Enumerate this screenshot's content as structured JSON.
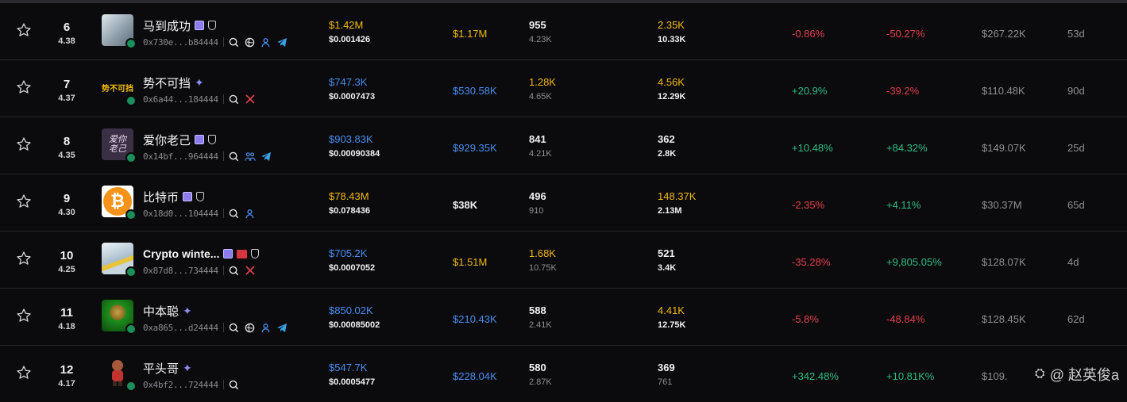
{
  "rows": [
    {
      "rank": "6",
      "score": "4.38",
      "name": "马到成功",
      "address": "0x730e...b84444",
      "avatar_colors": [
        "#c9d5de",
        "#7a8a96"
      ],
      "avatar_text": "",
      "market_cap": "$1.42M",
      "price": "$0.001426",
      "liquidity": "$1.17M",
      "txns": "955",
      "txns_sub": "4.23K",
      "volume": "2.35K",
      "volume_sub": "10.33K",
      "change_1": "-0.86%",
      "change_2": "-50.27%",
      "holders": "$267.22K",
      "age": "53d"
    },
    {
      "rank": "7",
      "score": "4.37",
      "name": "势不可挡",
      "address": "0x6a44...184444",
      "avatar_colors": [
        "#0b0b0d",
        "#0b0b0d"
      ],
      "avatar_text": "势不可挡",
      "market_cap": "$747.3K",
      "price": "$0.0007473",
      "liquidity": "$530.58K",
      "txns": "1.28K",
      "txns_sub": "4.65K",
      "volume": "4.56K",
      "volume_sub": "12.29K",
      "change_1": "+20.9%",
      "change_2": "-39.2%",
      "holders": "$110.48K",
      "age": "90d"
    },
    {
      "rank": "8",
      "score": "4.35",
      "name": "爱你老己",
      "address": "0x14bf...964444",
      "avatar_colors": [
        "#3b2f45",
        "#5d4a66"
      ],
      "avatar_text": "爱你老己",
      "market_cap": "$903.83K",
      "price": "$0.00090384",
      "liquidity": "$929.35K",
      "txns": "841",
      "txns_sub": "4.21K",
      "volume": "362",
      "volume_sub": "2.8K",
      "change_1": "+10.48%",
      "change_2": "+84.32%",
      "holders": "$149.07K",
      "age": "25d"
    },
    {
      "rank": "9",
      "score": "4.30",
      "name": "比特币",
      "address": "0x18d0...104444",
      "avatar_colors": [
        "#f7931a",
        "#f7931a"
      ],
      "avatar_text": "₿",
      "market_cap": "$78.43M",
      "price": "$0.078436",
      "liquidity": "$38K",
      "txns": "496",
      "txns_sub": "910",
      "volume": "148.37K",
      "volume_sub": "2.13M",
      "change_1": "-2.35%",
      "change_2": "+4.11%",
      "holders": "$30.37M",
      "age": "65d"
    },
    {
      "rank": "10",
      "score": "4.25",
      "name": "Crypto winte...",
      "address": "0x87d8...734444",
      "avatar_colors": [
        "#cfd8e0",
        "#7f97ad"
      ],
      "avatar_text": "",
      "market_cap": "$705.2K",
      "price": "$0.0007052",
      "liquidity": "$1.51M",
      "txns": "1.68K",
      "txns_sub": "10.75K",
      "volume": "521",
      "volume_sub": "3.4K",
      "change_1": "-35.28%",
      "change_2": "+9,805.05%",
      "holders": "$128.07K",
      "age": "4d"
    },
    {
      "rank": "11",
      "score": "4.18",
      "name": "中本聪",
      "address": "0xa865...d24444",
      "avatar_colors": [
        "#1e8f1e",
        "#0c3d0c"
      ],
      "avatar_text": "",
      "market_cap": "$850.02K",
      "price": "$0.00085002",
      "liquidity": "$210.43K",
      "txns": "588",
      "txns_sub": "2.41K",
      "volume": "4.41K",
      "volume_sub": "12.75K",
      "change_1": "-5.8%",
      "change_2": "-48.84%",
      "holders": "$128.45K",
      "age": "62d"
    },
    {
      "rank": "12",
      "score": "4.17",
      "name": "平头哥",
      "address": "0x4bf2...724444",
      "avatar_colors": [
        "#0b0b0d",
        "#0b0b0d"
      ],
      "avatar_text": "",
      "market_cap": "$547.7K",
      "price": "$0.0005477",
      "liquidity": "$228.04K",
      "txns": "580",
      "txns_sub": "2.87K",
      "volume": "369",
      "volume_sub": "761",
      "change_1": "+342.48%",
      "change_2": "+10.81K%",
      "holders": "$109.",
      "age": ""
    }
  ],
  "watermark": {
    "text": "@ 赵英俊a",
    "icon": "platform-logo-icon"
  },
  "colors": {
    "gold": "#f0b90b",
    "blue": "#4a8ef0",
    "green": "#2dbd85",
    "red": "#e2414c",
    "purple_badge": "#8d7bf0"
  }
}
